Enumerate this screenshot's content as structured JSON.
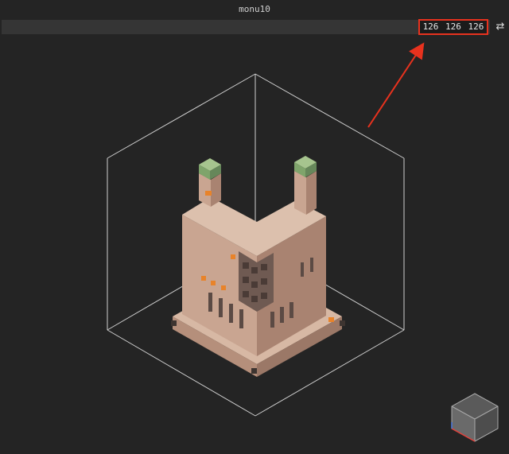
{
  "window": {
    "title": "monu10"
  },
  "toolbar": {
    "dimensions": "126 126 126",
    "swap_icon": "⇄"
  },
  "colors": {
    "background": "#242424",
    "highlight": "#e8321e",
    "model_wall": "#c9a48f",
    "model_shadow": "#8c6e60",
    "accent": "#e8832a"
  }
}
